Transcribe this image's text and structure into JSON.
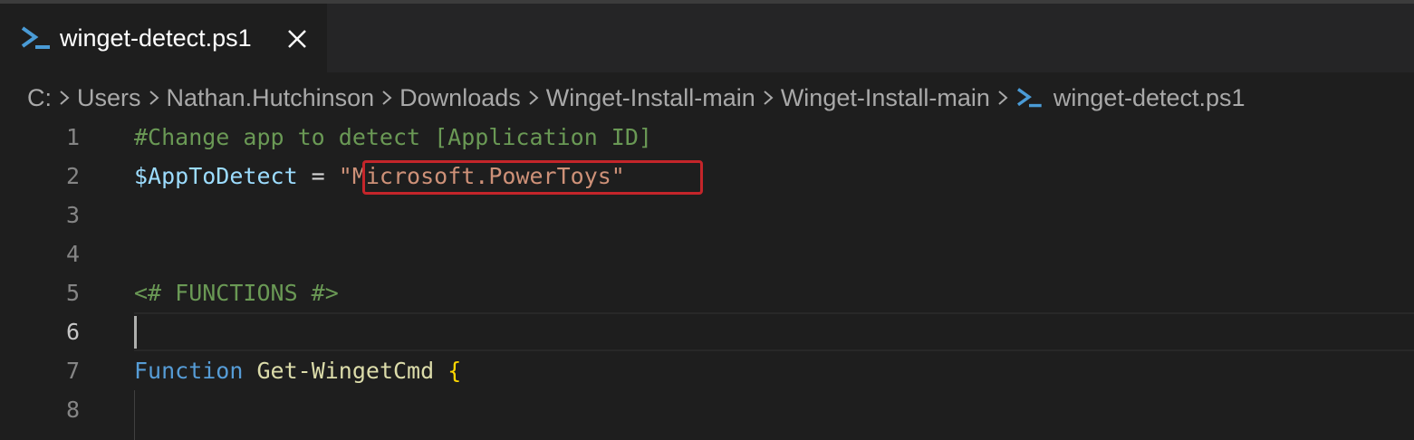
{
  "tab": {
    "label": "winget-detect.ps1",
    "icon": "powershell-icon",
    "close_icon": "close-icon"
  },
  "breadcrumb": {
    "items": [
      "C:",
      "Users",
      "Nathan.Hutchinson",
      "Downloads",
      "Winget-Install-main",
      "Winget-Install-main"
    ],
    "file": "winget-detect.ps1"
  },
  "editor": {
    "current_line": 6,
    "lines": [
      {
        "n": "1",
        "tokens": [
          {
            "t": "#Change app to detect [Application ID]",
            "c": "comment"
          }
        ]
      },
      {
        "n": "2",
        "tokens": [
          {
            "t": "$AppToDetect",
            "c": "var"
          },
          {
            "t": " = ",
            "c": "op"
          },
          {
            "t": "\"Microsoft.PowerToys\"",
            "c": "str"
          }
        ]
      },
      {
        "n": "3",
        "tokens": []
      },
      {
        "n": "4",
        "tokens": []
      },
      {
        "n": "5",
        "tokens": [
          {
            "t": "<# FUNCTIONS #>",
            "c": "comment"
          }
        ]
      },
      {
        "n": "6",
        "tokens": []
      },
      {
        "n": "7",
        "tokens": [
          {
            "t": "Function",
            "c": "kw"
          },
          {
            "t": " ",
            "c": "op"
          },
          {
            "t": "Get-WingetCmd",
            "c": "fn"
          },
          {
            "t": " ",
            "c": "op"
          },
          {
            "t": "{",
            "c": "brace"
          }
        ]
      },
      {
        "n": "8",
        "tokens": []
      }
    ]
  },
  "colors": {
    "background": "#1e1e1e",
    "highlight_box": "#c4252a",
    "powershell_icon": "#4a9bd6"
  }
}
